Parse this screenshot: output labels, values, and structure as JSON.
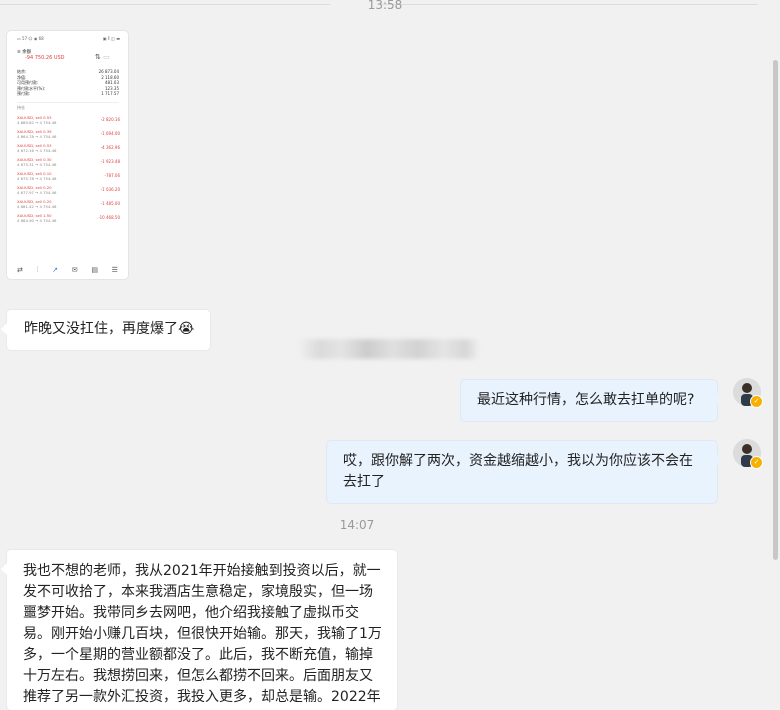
{
  "times": [
    "13:58",
    "14:07"
  ],
  "screenshot": {
    "status_left": "▭ 57 ☺ ◉ 68",
    "status_right": "▣ ⁑ ◫ ▬",
    "account_label": "余额",
    "account_value": "-94 750.26 USD",
    "summary": [
      {
        "label": "结余:",
        "value": "26 873.04"
      },
      {
        "label": "净值:",
        "value": "2 118.60"
      },
      {
        "label": "可用预付款:",
        "value": "481.03"
      },
      {
        "label": "预付款水平(%):",
        "value": "123.35"
      },
      {
        "label": "预付款:",
        "value": "1 717.57"
      }
    ],
    "section": "持仓",
    "positions": [
      {
        "symbol": "XAUUSD, sell 0.53",
        "sub": "4 689.82 → 4 754.46",
        "value": "-2 820.16"
      },
      {
        "symbol": "XAUUSD, sell 0.39",
        "sub": "4 664.78 → 4 754.46",
        "value": "-1 694.00"
      },
      {
        "symbol": "XAUUSD, sell 0.53",
        "sub": "4 672.16 → 4 754.46",
        "value": "-4 362.96"
      },
      {
        "symbol": "XAUUSD, sell 0.30",
        "sub": "4 675.31 → 4 754.46",
        "value": "-1 923.48"
      },
      {
        "symbol": "XAUUSD, sell 0.10",
        "sub": "4 675.78 → 4 754.46",
        "value": "-787.06"
      },
      {
        "symbol": "XAUUSD, sell 0.20",
        "sub": "4 677.97 → 4 754.46",
        "value": "-1 036.20"
      },
      {
        "symbol": "XAUUSD, sell 0.20",
        "sub": "4 681.42 → 4 754.46",
        "value": "-1 485.00"
      },
      {
        "symbol": "XAUUSD, sell 1.50",
        "sub": "4 684.90 → 4 754.46",
        "value": "-10 468.50"
      }
    ],
    "nav_icons": [
      "quotes-icon",
      "chart-icon",
      "trade-icon",
      "mail-icon",
      "history-icon",
      "chat-icon"
    ]
  },
  "messages": {
    "m1": "昨晚又没扛住，再度爆了😭",
    "m2": "最近这种行情，怎么敢去扛单的呢?",
    "m3": "哎，跟你解了两次，资金越缩越小，我以为你应该不会在去扛了",
    "m4": "我也不想的老师，我从2021年开始接触到投资以后，就一发不可收拾了，本来我酒店生意稳定，家境殷实，但一场噩梦开始。我带同乡去网吧，他介绍我接触了虚拟币交易。刚开始小赚几百块，但很快开始输。那天，我输了1万多，一个星期的营业额都没了。此后，我不断充值，输掉十万左右。我想捞回来，但怎么都捞不回来。后面朋友又推荐了另一款外汇投资，我投入更多，却总是输。2022年"
  },
  "colors": {
    "out_bubble": "#e9f3fd",
    "in_bubble": "#ffffff",
    "loss": "#e04040",
    "badge": "#f6b100"
  }
}
